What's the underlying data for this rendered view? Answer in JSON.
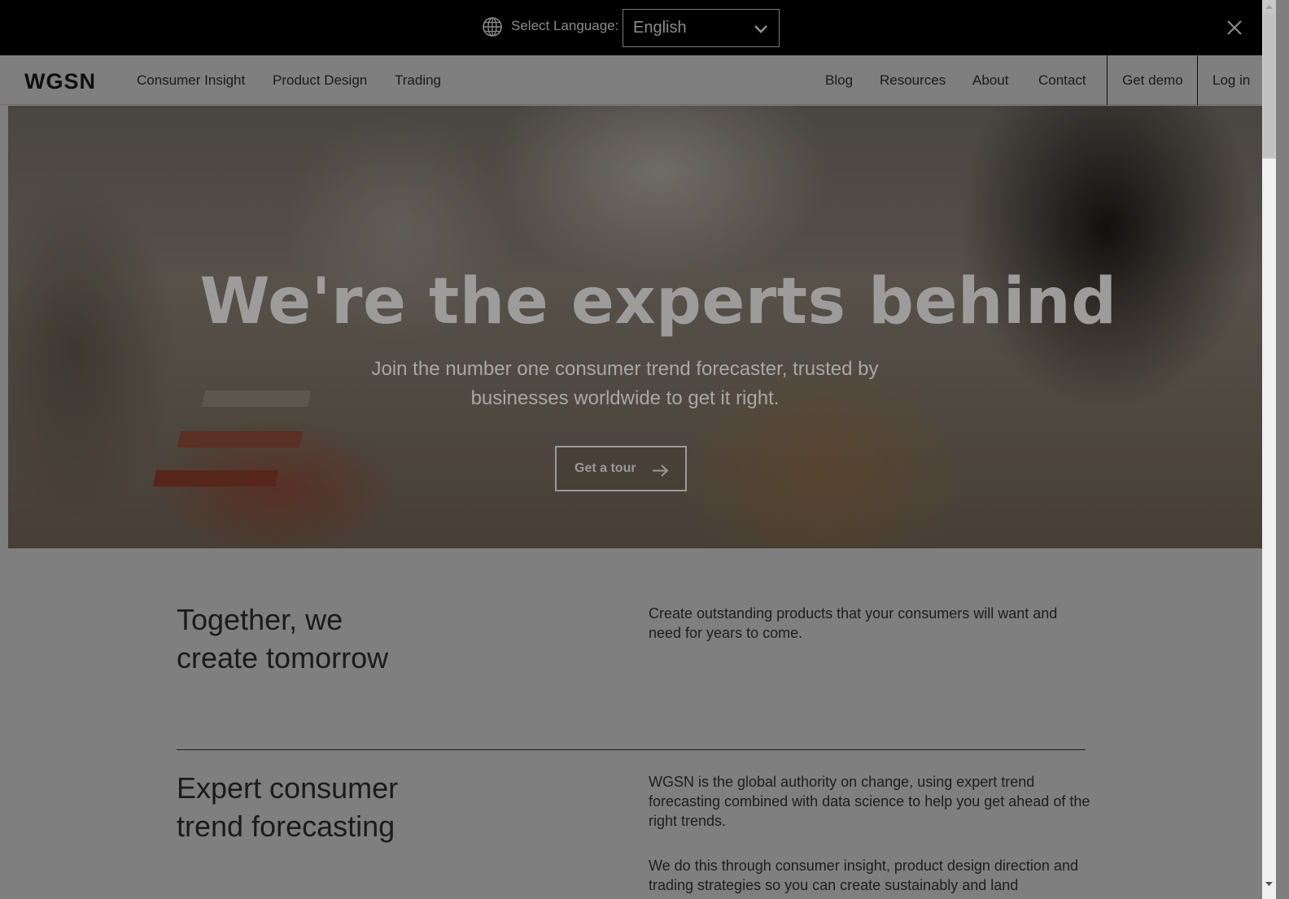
{
  "language_bar": {
    "label": "Select Language:",
    "selected": "English",
    "icons": {
      "globe": "globe-icon",
      "chevron": "chevron-down-icon",
      "close": "close-icon"
    }
  },
  "nav": {
    "logo": "WGSN",
    "left_items": [
      "Consumer Insight",
      "Product Design",
      "Trading"
    ],
    "right_items": [
      "Blog",
      "Resources",
      "About",
      "Contact"
    ],
    "get_demo": "Get demo",
    "log_in": "Log in"
  },
  "hero": {
    "title": "We're the experts behind",
    "subtitle_line1": "Join the number one consumer trend forecaster, trusted by",
    "subtitle_line2": "businesses worldwide to get it right.",
    "cta_label": "Get a tour",
    "cta_icon": "arrow-right-icon"
  },
  "sections": [
    {
      "title_line1": "Together, we",
      "title_line2": "create tomorrow",
      "paragraphs": [
        "Create outstanding products that your consumers will want and need for years to come."
      ]
    },
    {
      "title_line1": "Expert consumer",
      "title_line2": "trend forecasting",
      "paragraphs": [
        "WGSN is the global authority on change, using expert trend forecasting combined with data science to help you get ahead of the right trends.",
        "We do this through consumer insight, product design direction and trading strategies so you can create sustainably and land"
      ]
    }
  ],
  "colors": {
    "overlay_gray": "#7f7f7f",
    "language_bar_bg": "#000000",
    "text_dark": "#1b1b1b"
  }
}
